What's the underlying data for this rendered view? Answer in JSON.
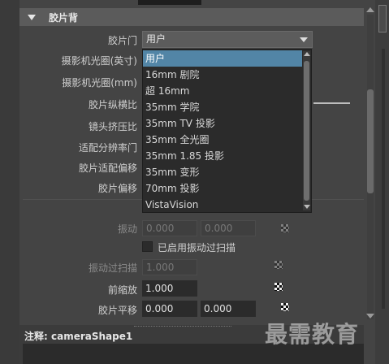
{
  "section": {
    "title": "胶片背"
  },
  "film_gate": {
    "label": "胶片门",
    "value": "用户",
    "options": [
      "用户",
      "16mm 剧院",
      "超 16mm",
      "35mm 学院",
      "35mm TV 投影",
      "35mm 全光圈",
      "35mm 1.85 投影",
      "35mm 变形",
      "70mm 投影",
      "VistaVision"
    ]
  },
  "labels": {
    "camera_aperture_inch": "摄影机光圈(英寸)",
    "camera_aperture_mm": "摄影机光圈(mm)",
    "film_aspect_ratio": "胶片纵横比",
    "lens_squeeze_ratio": "镜头挤压比",
    "fit_resolution_gate": "适配分辨率门",
    "film_fit_offset": "胶片适配偏移",
    "film_offset": "胶片偏移",
    "shake": "振动",
    "shake_enabled": "已启用振动过扫描",
    "shake_overscan": "振动过扫描",
    "pre_scale": "前缩放",
    "film_translate": "胶片平移"
  },
  "values": {
    "shake_x": "0.000",
    "shake_y": "0.000",
    "shake_overscan": "1.000",
    "pre_scale": "1.000",
    "film_translate_x": "0.000",
    "film_translate_y": "0.000"
  },
  "footer": {
    "label": "注释: cameraShape1"
  },
  "watermark": "最需教育",
  "colors": {
    "selection": "#5285a6",
    "background": "#444444",
    "field": "#2b2b2b"
  }
}
